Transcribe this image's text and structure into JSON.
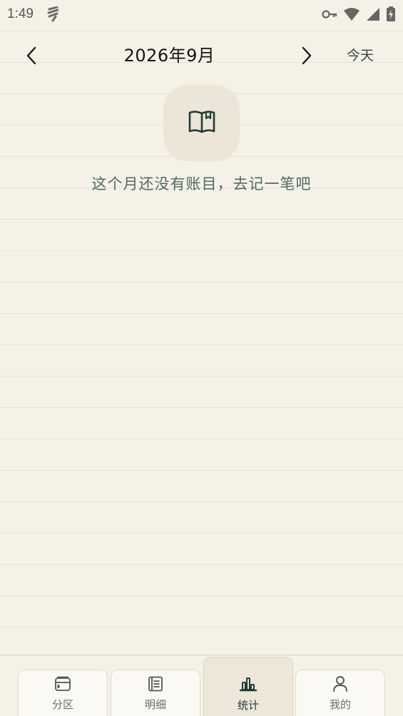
{
  "status_bar": {
    "time": "1:49",
    "icons": [
      "notification-icon",
      "vpn-key-icon",
      "wifi-icon",
      "signal-icon",
      "battery-charging-icon"
    ]
  },
  "header": {
    "month_title": "2026年9月",
    "prev_icon": "chevron-left-icon",
    "next_icon": "chevron-right-icon",
    "today_label": "今天"
  },
  "empty_state": {
    "icon": "open-book-icon",
    "message": "这个月还没有账目，去记一笔吧"
  },
  "tabs": [
    {
      "label": "分区",
      "icon": "wallet-icon",
      "active": false
    },
    {
      "label": "明细",
      "icon": "list-icon",
      "active": false
    },
    {
      "label": "统计",
      "icon": "bar-chart-icon",
      "active": true
    },
    {
      "label": "我的",
      "icon": "person-icon",
      "active": false
    }
  ],
  "colors": {
    "background": "#f5f1e7",
    "accent": "#1c3b33",
    "empty_text": "#4f6b62",
    "icon_tile": "#ece6d9"
  }
}
